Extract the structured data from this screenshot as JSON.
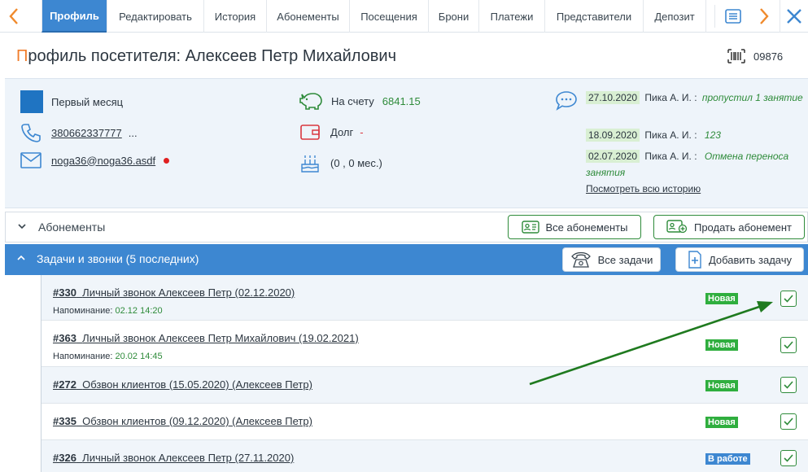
{
  "tabs": [
    {
      "label": "Профиль",
      "active": true
    },
    {
      "label": "Редактировать"
    },
    {
      "label": "История"
    },
    {
      "label": "Абонементы"
    },
    {
      "label": "Посещения"
    },
    {
      "label": "Брони"
    },
    {
      "label": "Платежи"
    },
    {
      "label": "Представители"
    },
    {
      "label": "Депозит"
    }
  ],
  "header": {
    "title_first_letter": "П",
    "title_rest": "рофиль посетителя: Алексеев Петр Михайлович",
    "card_number": "09876"
  },
  "info": {
    "level": "Первый месяц",
    "phone": "380662337777",
    "phone_more": "...",
    "email": "noga36@noga36.asdf",
    "balance_label": "На счету",
    "balance_value": "6841.15",
    "debt_label": "Долг",
    "debt_value": "-",
    "birthday_value": "(0 , 0 мес.)",
    "history": [
      {
        "date": "27.10.2020",
        "author": "Пика А. И. :",
        "note": "пропустил 1 занятие"
      },
      {
        "date": "18.09.2020",
        "author": "Пика А. И. :",
        "note": "123"
      },
      {
        "date": "02.07.2020",
        "author": "Пика А. И. :",
        "note": "Отмена переноса занятия"
      }
    ],
    "history_link": "Посмотреть всю историю"
  },
  "abonements": {
    "label": "Абонементы",
    "all_button": "Все абонементы",
    "sell_button": "Продать абонемент"
  },
  "tasks_section": {
    "label": "Задачи и звонки (5 последних)",
    "all_button": "Все задачи",
    "add_button": "Добавить задачу"
  },
  "tasks": [
    {
      "number": "#330",
      "title": "Личный звонок Алексеев Петр (02.12.2020)",
      "reminder_label": "Напоминание:",
      "reminder": "02.12 14:20",
      "status": "Новая"
    },
    {
      "number": "#363",
      "title": "Личный звонок Алексеев Петр Михайлович (19.02.2021)",
      "reminder_label": "Напоминание:",
      "reminder": "20.02 14:45",
      "status": "Новая"
    },
    {
      "number": "#272",
      "title": "Обзвон клиентов (15.05.2020) (Алексеев Петр)",
      "status": "Новая"
    },
    {
      "number": "#335",
      "title": "Обзвон клиентов (09.12.2020) (Алексеев Петр)",
      "status": "Новая"
    },
    {
      "number": "#326",
      "title": "Личный звонок Алексеев Петр (27.11.2020)",
      "status": "В работе"
    }
  ],
  "colors": {
    "accent": "#3d87d1",
    "title_first": "#f07c2a",
    "green": "#2e8b3a",
    "status_new": "#2fae3e",
    "status_work": "#3d87d1",
    "annotation_arrow": "#1f7a1f"
  }
}
